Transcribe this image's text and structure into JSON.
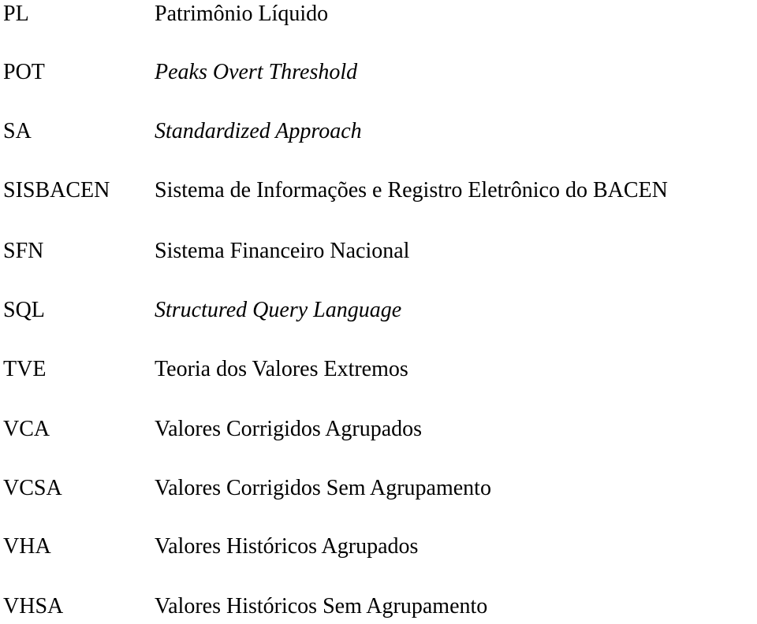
{
  "entries": [
    {
      "abbr": "PL",
      "definition": "Patrimônio Líquido",
      "italic": false
    },
    {
      "abbr": "POT",
      "definition": "Peaks Overt Threshold",
      "italic": true
    },
    {
      "abbr": "SA",
      "definition": "Standardized Approach",
      "italic": true
    },
    {
      "abbr": "SISBACEN",
      "definition": "Sistema de Informações e Registro Eletrônico do BACEN",
      "italic": false
    },
    {
      "abbr": "SFN",
      "definition": "Sistema Financeiro Nacional",
      "italic": false
    },
    {
      "abbr": "SQL",
      "definition": "Structured Query Language",
      "italic": true
    },
    {
      "abbr": "TVE",
      "definition": "Teoria dos Valores Extremos",
      "italic": false
    },
    {
      "abbr": "VCA",
      "definition": "Valores Corrigidos Agrupados",
      "italic": false
    },
    {
      "abbr": "VCSA",
      "definition": "Valores Corrigidos Sem Agrupamento",
      "italic": false
    },
    {
      "abbr": "VHA",
      "definition": "Valores Históricos Agrupados",
      "italic": false
    },
    {
      "abbr": "VHSA",
      "definition": "Valores Históricos Sem Agrupamento",
      "italic": false
    }
  ]
}
